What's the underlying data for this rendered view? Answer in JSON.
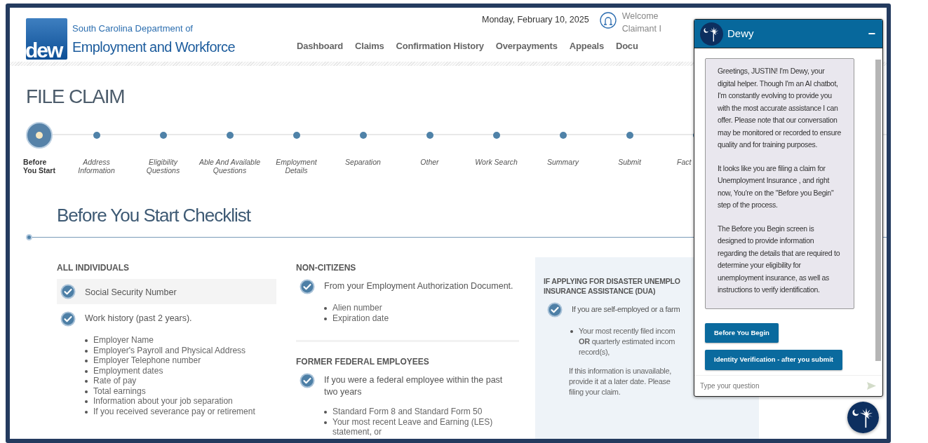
{
  "header": {
    "org_line": "South Carolina Department of",
    "org_name": "Employment and Workforce",
    "logo_text": "dew",
    "date": "Monday, February 10, 2025",
    "welcome": "Welcome",
    "user_id_label": "Claimant I"
  },
  "nav": [
    {
      "label": "Dashboard"
    },
    {
      "label": "Claims"
    },
    {
      "label": "Confirmation History"
    },
    {
      "label": "Overpayments"
    },
    {
      "label": "Appeals"
    },
    {
      "label": "Docu"
    }
  ],
  "page_title": "FILE CLAIM",
  "steps": [
    {
      "label": "Before\nYou Start",
      "selected": true
    },
    {
      "label": "Address\nInformation",
      "selected": false
    },
    {
      "label": "Eligibility\nQuestions",
      "selected": false
    },
    {
      "label": "Able And Available\nQuestions",
      "selected": false
    },
    {
      "label": "Employment\nDetails",
      "selected": false
    },
    {
      "label": "Separation",
      "selected": false
    },
    {
      "label": "Other",
      "selected": false
    },
    {
      "label": "Work Search",
      "selected": false
    },
    {
      "label": "Summary",
      "selected": false
    },
    {
      "label": "Submit",
      "selected": false
    },
    {
      "label": "Fact",
      "selected": false
    }
  ],
  "section_title": "Before You Start Checklist",
  "columns": [
    {
      "kind": "plain",
      "groups": [
        {
          "heading": [
            "ALL INDIVIDUALS"
          ],
          "items": [
            {
              "text": "Social Security Number",
              "shaded": true
            },
            {
              "text": "Work history (past 2 years).",
              "shaded": false,
              "bullets": [
                "Employer Name",
                "Employer's Payroll and Physical Address",
                "Employer Telephone number",
                "Employment dates",
                "Rate of pay",
                "Total earnings",
                "Information about your job separation",
                "If you received severance pay or retirement"
              ]
            }
          ]
        }
      ]
    },
    {
      "kind": "plain",
      "groups": [
        {
          "heading": [
            "NON-CITIZENS"
          ],
          "items": [
            {
              "text": "From your Employment Authorization Document.",
              "shaded": false,
              "bullets": [
                "Alien number",
                "Expiration date"
              ]
            }
          ]
        },
        {
          "heading": [
            "FORMER FEDERAL EMPLOYEES"
          ],
          "items": [
            {
              "text": "If you were a federal employee within the past two years",
              "shaded": false,
              "bullets": [
                "Standard Form 8 and Standard Form 50",
                "Your most recent Leave and Earning (LES) statement, or"
              ]
            }
          ]
        }
      ]
    },
    {
      "kind": "shaded",
      "groups": [
        {
          "heading": [
            "IF APPLYING FOR DISASTER UNEMPLO",
            "INSURANCE ASSISTANCE (DUA)"
          ],
          "items": [
            {
              "text": "If you are self-employed or a farm",
              "shaded": false,
              "bullet_lines": [
                "Your most recently filed incom",
                "**OR** quarterly estimated incom",
                "record(s),"
              ],
              "note_lines": [
                "If this information is unavailable,",
                "provide it at a later date. Please",
                "filing your claim."
              ]
            }
          ]
        }
      ]
    }
  ],
  "chat": {
    "title": "Dewy",
    "minimize": "−",
    "messages": [
      "Greetings, JUSTIN! I'm Dewy, your digital helper. Though I'm an AI chatbot, I'm constantly evolving to provide you with the most accurate assistance I can offer. Please note that our conversation may be monitored or recorded to ensure quality and for training purposes.",
      "It looks like you are filing a claim for Unemployment Insurance , and right now, You're on the \"Before you Begin\" step of the process.",
      "The Before you Begin screen is designed to provide information regarding the details that are required to determine your eligibility for unemployment insurance, as well as instructions to verify identification."
    ],
    "buttons": [
      "Before You Begin",
      "Identity Verification - after you submit"
    ],
    "input": {
      "placeholder": "Type your question"
    }
  }
}
